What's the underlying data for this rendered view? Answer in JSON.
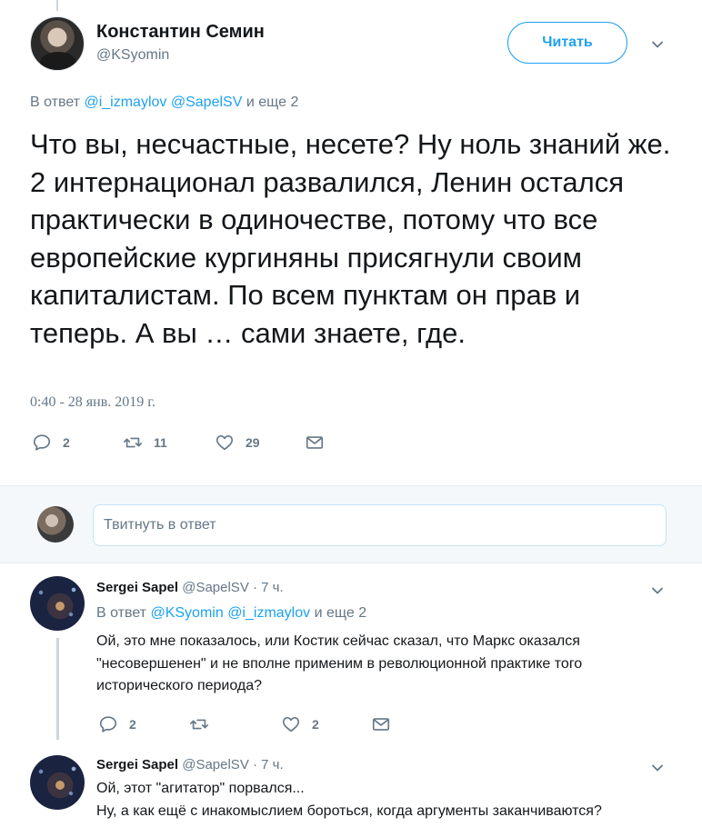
{
  "main_tweet": {
    "author_name": "Константин Семин",
    "author_handle": "@KSyomin",
    "follow_label": "Читать",
    "reply_to_prefix": "В ответ",
    "reply_to_users": [
      "@i_izmaylov",
      "@SapelSV"
    ],
    "reply_to_more": "и еще 2",
    "text": "Что вы, несчастные, несете? Ну ноль знаний же. 2 интернационал развалился, Ленин остался практически в одиночестве, потому что все европейские кургиняны присягнули своим капиталистам. По всем пунктам он прав и теперь. А вы … сами знаете, где.",
    "timestamp": "0:40 - 28 янв. 2019 г.",
    "actions": {
      "reply_icon": "reply-bubble-icon",
      "reply_count": "2",
      "retweet_icon": "retweet-icon",
      "retweet_count": "11",
      "like_icon": "heart-icon",
      "like_count": "29",
      "dm_icon": "envelope-icon"
    }
  },
  "composer": {
    "placeholder": "Твитнуть в ответ"
  },
  "comments": [
    {
      "name": "Sergei Sapel",
      "handle": "@SapelSV",
      "sep": "·",
      "time": "7 ч.",
      "reply_to_prefix": "В ответ",
      "reply_to_users": [
        "@KSyomin",
        "@i_izmaylov"
      ],
      "reply_to_more": "и еще 2",
      "text_lines": [
        "Ой, это мне показалось, или Костик сейчас сказал, что Маркс оказался",
        "\"несовершенен\" и не вполне применим в революционной практике того",
        "исторического периода?"
      ],
      "reply_count": "2",
      "like_count": "2"
    },
    {
      "name": "Sergei Sapel",
      "handle": "@SapelSV",
      "sep": "·",
      "time": "7 ч.",
      "text_lines": [
        "Ой, этот \"агитатор\" порвался...",
        "Ну, а как ещё с инакомыслием бороться, когда аргументы заканчиваются?"
      ]
    }
  ],
  "colors": {
    "accent": "#1da1f2",
    "muted": "#657786",
    "text": "#14171a",
    "icon": "#657786"
  }
}
